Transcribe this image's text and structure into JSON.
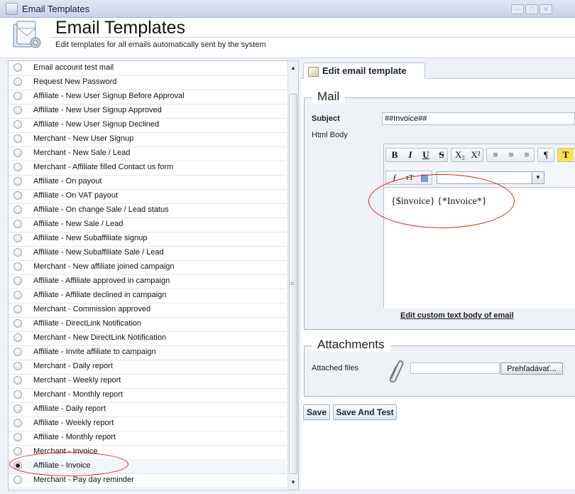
{
  "window": {
    "title": "Email Templates",
    "controls": [
      "minimize",
      "maximize",
      "close"
    ]
  },
  "header": {
    "title": "Email Templates",
    "subtitle": "Edit templates for all emails automatically sent by the system",
    "icon": "email-templates-icon"
  },
  "templates": [
    {
      "label": "Email account test mail",
      "selected": false
    },
    {
      "label": "Request New Password",
      "selected": false
    },
    {
      "label": "Affiliate - New User Signup Before Approval",
      "selected": false
    },
    {
      "label": "Affiliate - New User Signup Approved",
      "selected": false
    },
    {
      "label": "Affiliate - New User Signup Declined",
      "selected": false
    },
    {
      "label": "Merchant - New User Signup",
      "selected": false
    },
    {
      "label": "Merchant - New Sale / Lead",
      "selected": false
    },
    {
      "label": "Merchant - Affiliate filled Contact us form",
      "selected": false
    },
    {
      "label": "Affiliate - On payout",
      "selected": false
    },
    {
      "label": "Affiliate - On VAT payout",
      "selected": false
    },
    {
      "label": "Affiliate - On change Sale / Lead status",
      "selected": false
    },
    {
      "label": "Affiliate - New Sale / Lead",
      "selected": false
    },
    {
      "label": "Affiliate - New Subaffiliate signup",
      "selected": false
    },
    {
      "label": "Affiliate - New Subaffiliate Sale / Lead",
      "selected": false
    },
    {
      "label": "Merchant - New affiliate joined campaign",
      "selected": false
    },
    {
      "label": "Affiliate - Affiliate approved in campaign",
      "selected": false
    },
    {
      "label": "Affiliate - Affiliate declined in campaign",
      "selected": false
    },
    {
      "label": "Merchant - Commission approved",
      "selected": false
    },
    {
      "label": "Affiliate - DirectLink Notification",
      "selected": false
    },
    {
      "label": "Merchant - New DirectLink Notification",
      "selected": false
    },
    {
      "label": "Affiliate - Invite affiliate to campaign",
      "selected": false
    },
    {
      "label": "Merchant - Daily report",
      "selected": false
    },
    {
      "label": "Merchant - Weekly report",
      "selected": false
    },
    {
      "label": "Merchant - Monthly report",
      "selected": false
    },
    {
      "label": "Affiliate - Daily report",
      "selected": false
    },
    {
      "label": "Affiliate - Weekly report",
      "selected": false
    },
    {
      "label": "Affiliate - Monthly report",
      "selected": false
    },
    {
      "label": "Merchant - Invoice",
      "selected": false
    },
    {
      "label": "Affiliate - Invoice",
      "selected": true
    },
    {
      "label": "Merchant - Pay day reminder",
      "selected": false
    }
  ],
  "editor_tab": {
    "label": "Edit email template"
  },
  "mail": {
    "legend": "Mail",
    "subject_label": "Subject",
    "subject_value": "##Invoice##",
    "html_body_label": "Html Body",
    "toolbar": {
      "bold": "B",
      "italic": "I",
      "underline": "U",
      "strike": "S",
      "subscript": "X₂",
      "superscript": "X²"
    },
    "body_content": "{$invoice} {*Invoice*}",
    "custom_link": "Edit custom text body of email"
  },
  "attachments": {
    "legend": "Attachments",
    "files_label": "Attached files",
    "browse_label": "Prehľadávať..."
  },
  "actions": {
    "save": "Save",
    "save_and_test": "Save And Test"
  },
  "colors": {
    "annotation_ellipse": "#dd2222",
    "panel_border": "#b8c6d8",
    "background": "#eef1f6"
  }
}
